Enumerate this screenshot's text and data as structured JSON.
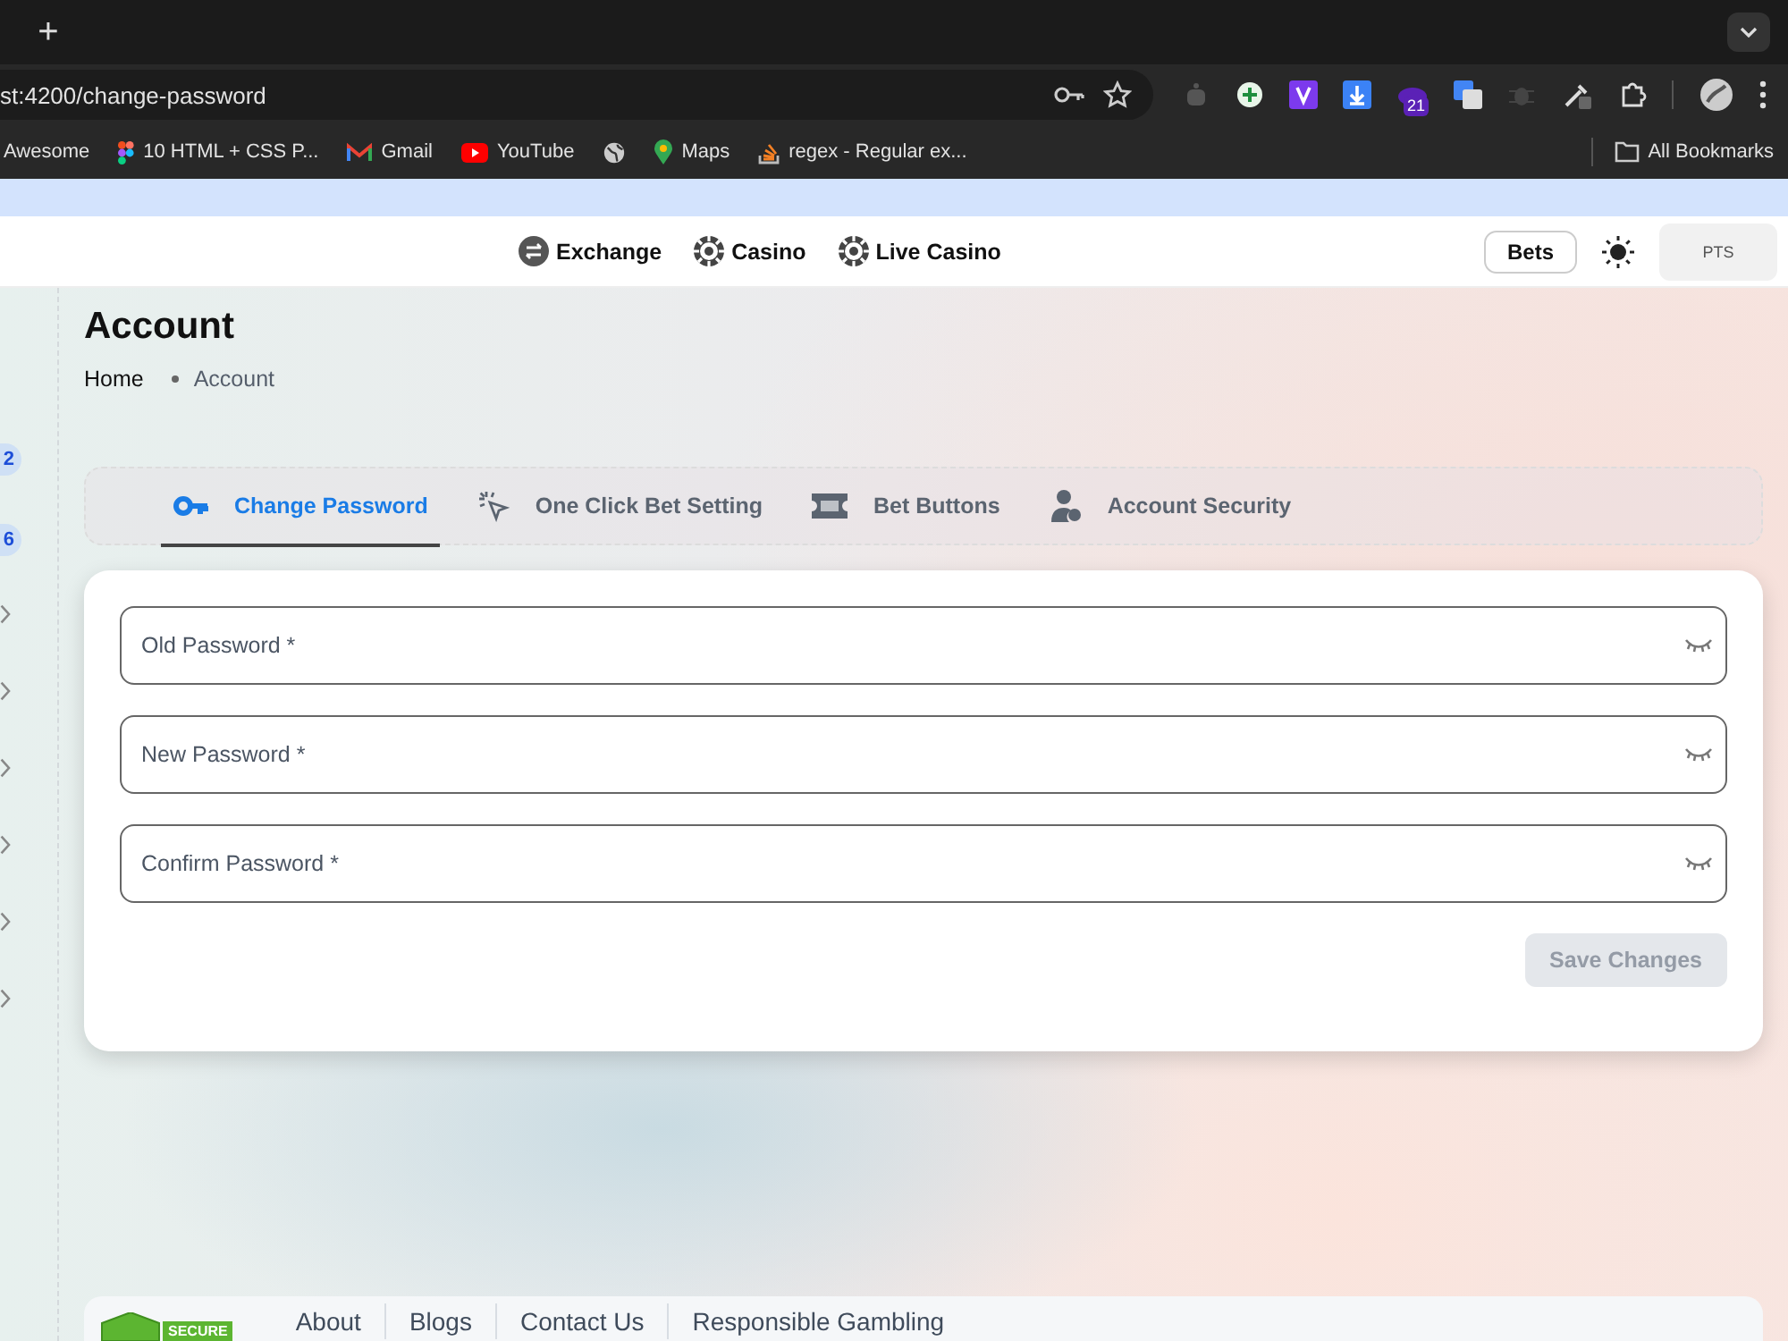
{
  "browser": {
    "new_tab": "+",
    "url": "st:4200/change-password",
    "extension_badge": "21",
    "bookmarks": [
      {
        "kind": "plain",
        "label": "Awesome"
      },
      {
        "kind": "figma",
        "label": "10 HTML + CSS P..."
      },
      {
        "kind": "gmail",
        "label": "Gmail"
      },
      {
        "kind": "youtube",
        "label": "YouTube"
      },
      {
        "kind": "globe"
      },
      {
        "kind": "maps",
        "label": "Maps"
      },
      {
        "kind": "stack",
        "label": "regex - Regular ex..."
      }
    ],
    "all_bookmarks": "All Bookmarks"
  },
  "header": {
    "nav": [
      {
        "kind": "exchange",
        "label": "Exchange"
      },
      {
        "kind": "chip",
        "label": "Casino"
      },
      {
        "kind": "chip",
        "label": "Live Casino"
      }
    ],
    "bets": "Bets",
    "points": "PTS"
  },
  "sidebar": {
    "items": [
      {
        "kind": "badge",
        "label": "2"
      },
      {
        "kind": "badge",
        "label": "6"
      },
      {
        "kind": "chevron"
      },
      {
        "kind": "chevron"
      },
      {
        "kind": "chevron"
      },
      {
        "kind": "chevron"
      },
      {
        "kind": "chevron"
      },
      {
        "kind": "chevron"
      }
    ]
  },
  "page": {
    "title": "Account",
    "breadcrumbs": [
      "Home",
      "Account"
    ]
  },
  "tabs": [
    {
      "kind": "key",
      "label": "Change Password",
      "selected": true
    },
    {
      "kind": "click",
      "label": "One Click Bet Setting",
      "selected": false
    },
    {
      "kind": "ticket",
      "label": "Bet Buttons",
      "selected": false
    },
    {
      "kind": "users",
      "label": "Account Security",
      "selected": false
    }
  ],
  "form": {
    "fields": [
      {
        "placeholder": "Old Password *"
      },
      {
        "placeholder": "New Password *"
      },
      {
        "placeholder": "Confirm Password *"
      }
    ],
    "save": {
      "label": "Save Changes",
      "disabled": true
    }
  },
  "footer": {
    "badge": "SECURE",
    "links": [
      "About",
      "Blogs",
      "Contact Us",
      "Responsible Gambling"
    ]
  }
}
